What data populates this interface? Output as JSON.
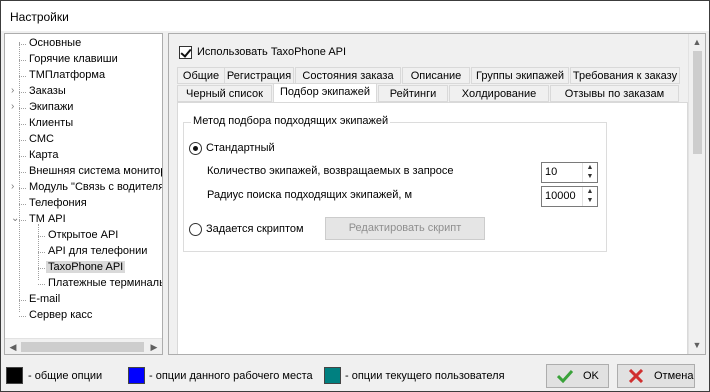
{
  "window": {
    "title": "Настройки"
  },
  "tree": {
    "items": [
      {
        "label": "Основные",
        "level": 0,
        "expandable": false
      },
      {
        "label": "Горячие клавиши",
        "level": 0,
        "expandable": false
      },
      {
        "label": "ТМПлатформа",
        "level": 0,
        "expandable": false
      },
      {
        "label": "Заказы",
        "level": 0,
        "expandable": true
      },
      {
        "label": "Экипажи",
        "level": 0,
        "expandable": true
      },
      {
        "label": "Клиенты",
        "level": 0,
        "expandable": false
      },
      {
        "label": "СМС",
        "level": 0,
        "expandable": false
      },
      {
        "label": "Карта",
        "level": 0,
        "expandable": false
      },
      {
        "label": "Внешняя система монитори",
        "level": 0,
        "expandable": false
      },
      {
        "label": "Модуль \"Связь с водителя",
        "level": 0,
        "expandable": true
      },
      {
        "label": "Телефония",
        "level": 0,
        "expandable": false
      },
      {
        "label": "ТМ API",
        "level": 0,
        "expandable": true,
        "expanded": true
      },
      {
        "label": "Открытое API",
        "level": 1,
        "expandable": false
      },
      {
        "label": "API для телефонии",
        "level": 1,
        "expandable": false
      },
      {
        "label": "TaxoPhone API",
        "level": 1,
        "expandable": false,
        "selected": true
      },
      {
        "label": "Платежные терминалы",
        "level": 1,
        "expandable": false
      },
      {
        "label": "E-mail",
        "level": 0,
        "expandable": false
      },
      {
        "label": "Сервер касс",
        "level": 0,
        "expandable": false
      }
    ]
  },
  "panel": {
    "use_api_label": "Использовать TaxoPhone API",
    "use_api_checked": true,
    "tabs_row1": [
      "Общие",
      "Регистрация",
      "Состояния заказа",
      "Описание",
      "Группы экипажей",
      "Требования к заказу"
    ],
    "tabs_row2": [
      "Черный список",
      "Подбор экипажей",
      "Рейтинги",
      "Холдирование",
      "Отзывы по заказам"
    ],
    "active_tab": "Подбор экипажей",
    "group_title": "Метод подбора подходящих экипажей",
    "radio_standard": "Стандартный",
    "count_label": "Количество экипажей, возвращаемых в запросе",
    "count_value": "10",
    "radius_label": "Радиус поиска подходящих экипажей, м",
    "radius_value": "10000",
    "radio_script": "Задается скриптом",
    "edit_script_button": "Редактировать скрипт"
  },
  "footer": {
    "legend": [
      {
        "color": "#000000",
        "label": "- общие опции"
      },
      {
        "color": "#0000ff",
        "label": "- опции данного рабочего места"
      },
      {
        "color": "#008080",
        "label": "- опции текущего пользователя"
      }
    ],
    "ok_label": "OK",
    "cancel_label": "Отмена"
  }
}
